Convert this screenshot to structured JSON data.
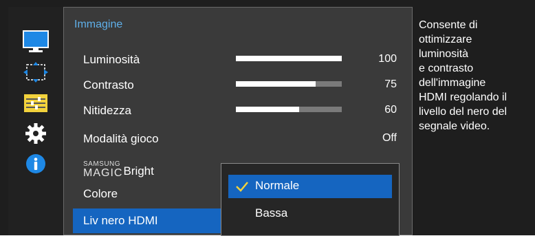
{
  "sidebar": {
    "items": [
      {
        "icon": "monitor-picture-icon",
        "active": true
      },
      {
        "icon": "screen-adjust-arrows-icon",
        "active": false
      },
      {
        "icon": "sliders-settings-icon",
        "active": false
      },
      {
        "icon": "gear-icon",
        "active": false
      },
      {
        "icon": "info-icon",
        "active": false
      }
    ]
  },
  "menu": {
    "title": "Immagine",
    "rows": [
      {
        "label": "Luminosità",
        "value": "100",
        "level": 1.0
      },
      {
        "label": "Contrasto",
        "value": "75",
        "level": 0.75
      },
      {
        "label": "Nitidezza",
        "value": "60",
        "level": 0.6
      },
      {
        "label": "Modalità gioco",
        "value": "Off"
      },
      {
        "label_sup": "SAMSUNG",
        "label_main": "MAGIC",
        "label_suffix": "Bright"
      },
      {
        "label": "Colore"
      },
      {
        "label": "Liv nero HDMI",
        "selected": true
      }
    ]
  },
  "dropdown": {
    "options": [
      {
        "label": "Normale",
        "selected": true
      },
      {
        "label": "Bassa",
        "selected": false
      }
    ]
  },
  "help": {
    "text": "Consente di\nottimizzare\nluminosità\ne contrasto\ndell'immagine\nHDMI regolando il\nlivello del nero del\nsegnale video."
  },
  "colors": {
    "accent": "#1565c0",
    "title": "#5fb0ea",
    "panel": "#3a3a3a",
    "background": "#1e1e1e"
  }
}
